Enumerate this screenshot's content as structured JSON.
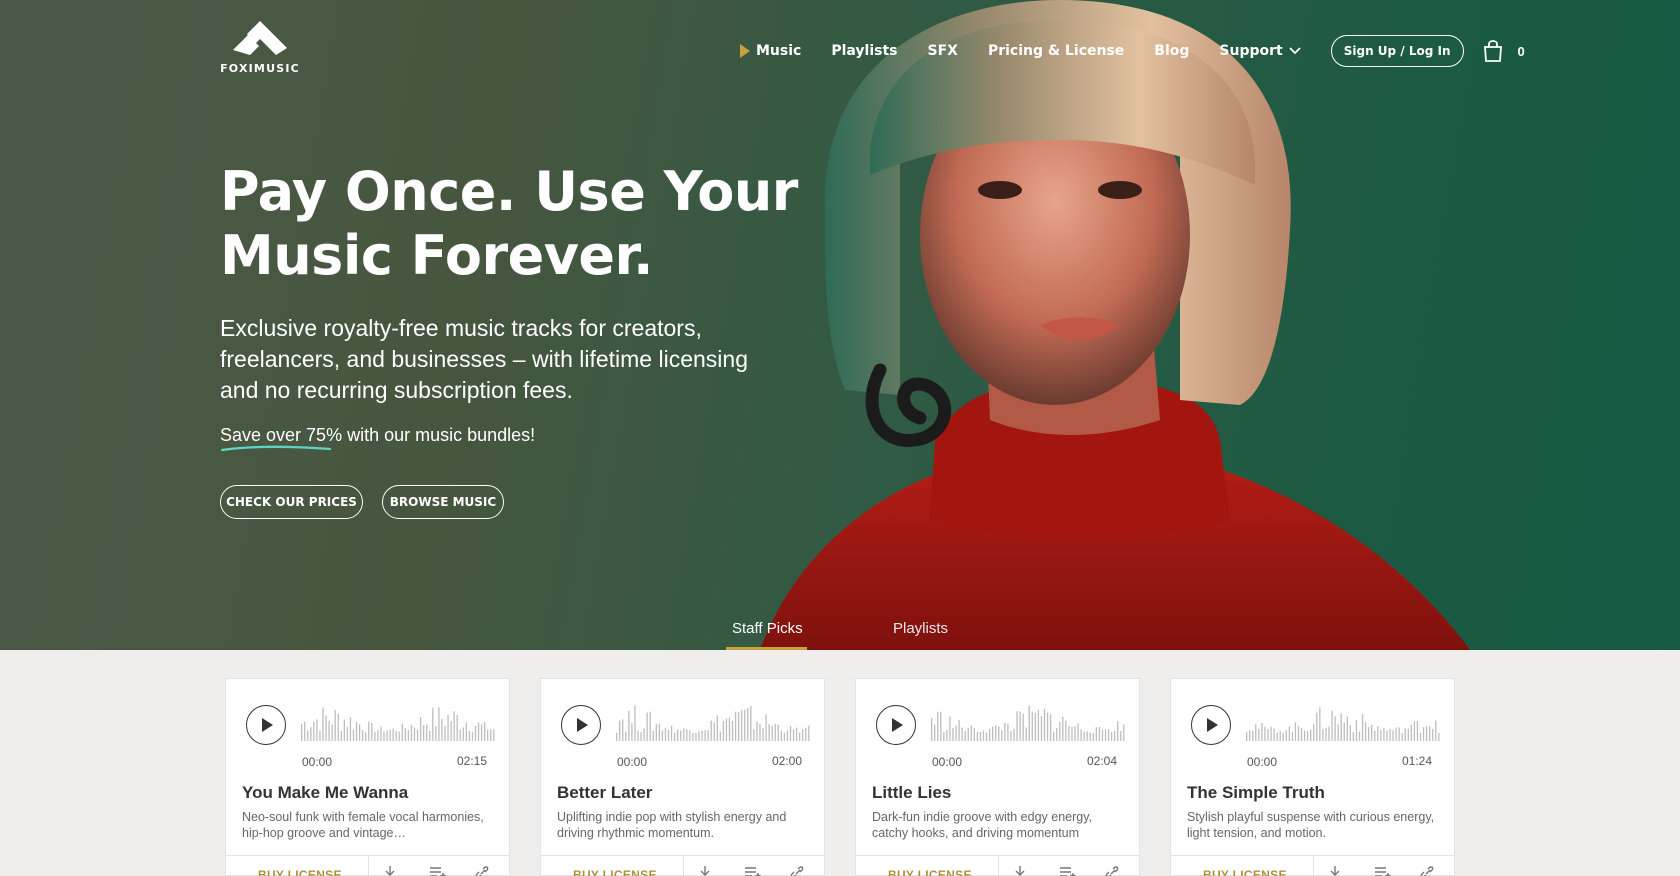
{
  "brand": {
    "name": "FOXIMUSIC"
  },
  "nav": {
    "items": [
      "Music",
      "Playlists",
      "SFX",
      "Pricing & License",
      "Blog",
      "Support"
    ],
    "signup": "Sign Up / Log In",
    "cart_count": "0"
  },
  "hero": {
    "headline_line1": "Pay Once. Use Your",
    "headline_line2": "Music Forever.",
    "subtext": "Exclusive royalty-free music tracks for creators, freelancers, and businesses – with lifetime licensing and no recurring subscription fees.",
    "save_highlight": "Save over 75%",
    "save_rest": " with our music bundles!",
    "cta_prices": "CHECK OUR PRICES",
    "cta_browse": "BROWSE MUSIC"
  },
  "tabs": [
    "Staff Picks",
    "Playlists"
  ],
  "tracks": [
    {
      "title": "You Make Me Wanna",
      "start": "00:00",
      "duration": "02:15",
      "description": "Neo-soul funk with female vocal harmonies, hip-hop groove and vintage…",
      "buy": "BUY LICENSE"
    },
    {
      "title": "Better Later",
      "start": "00:00",
      "duration": "02:00",
      "description": "Uplifting indie pop with stylish energy and driving rhythmic momentum.",
      "buy": "BUY LICENSE"
    },
    {
      "title": "Little Lies",
      "start": "00:00",
      "duration": "02:04",
      "description": "Dark-fun indie groove with edgy energy, catchy hooks, and driving momentum",
      "buy": "BUY LICENSE"
    },
    {
      "title": "The Simple Truth",
      "start": "00:00",
      "duration": "01:24",
      "description": "Stylish playful suspense with curious energy, light tension, and motion.",
      "buy": "BUY LICENSE"
    }
  ],
  "colors": {
    "accent": "#c7a23f",
    "hero_green": "#1c5a42",
    "sweater_red": "#b01a14",
    "underline_teal": "#5fd3c4"
  },
  "icons": [
    "logo-mark",
    "play-icon",
    "chevron-down-icon",
    "cart-icon",
    "download-icon",
    "add-to-playlist-icon",
    "link-icon"
  ]
}
